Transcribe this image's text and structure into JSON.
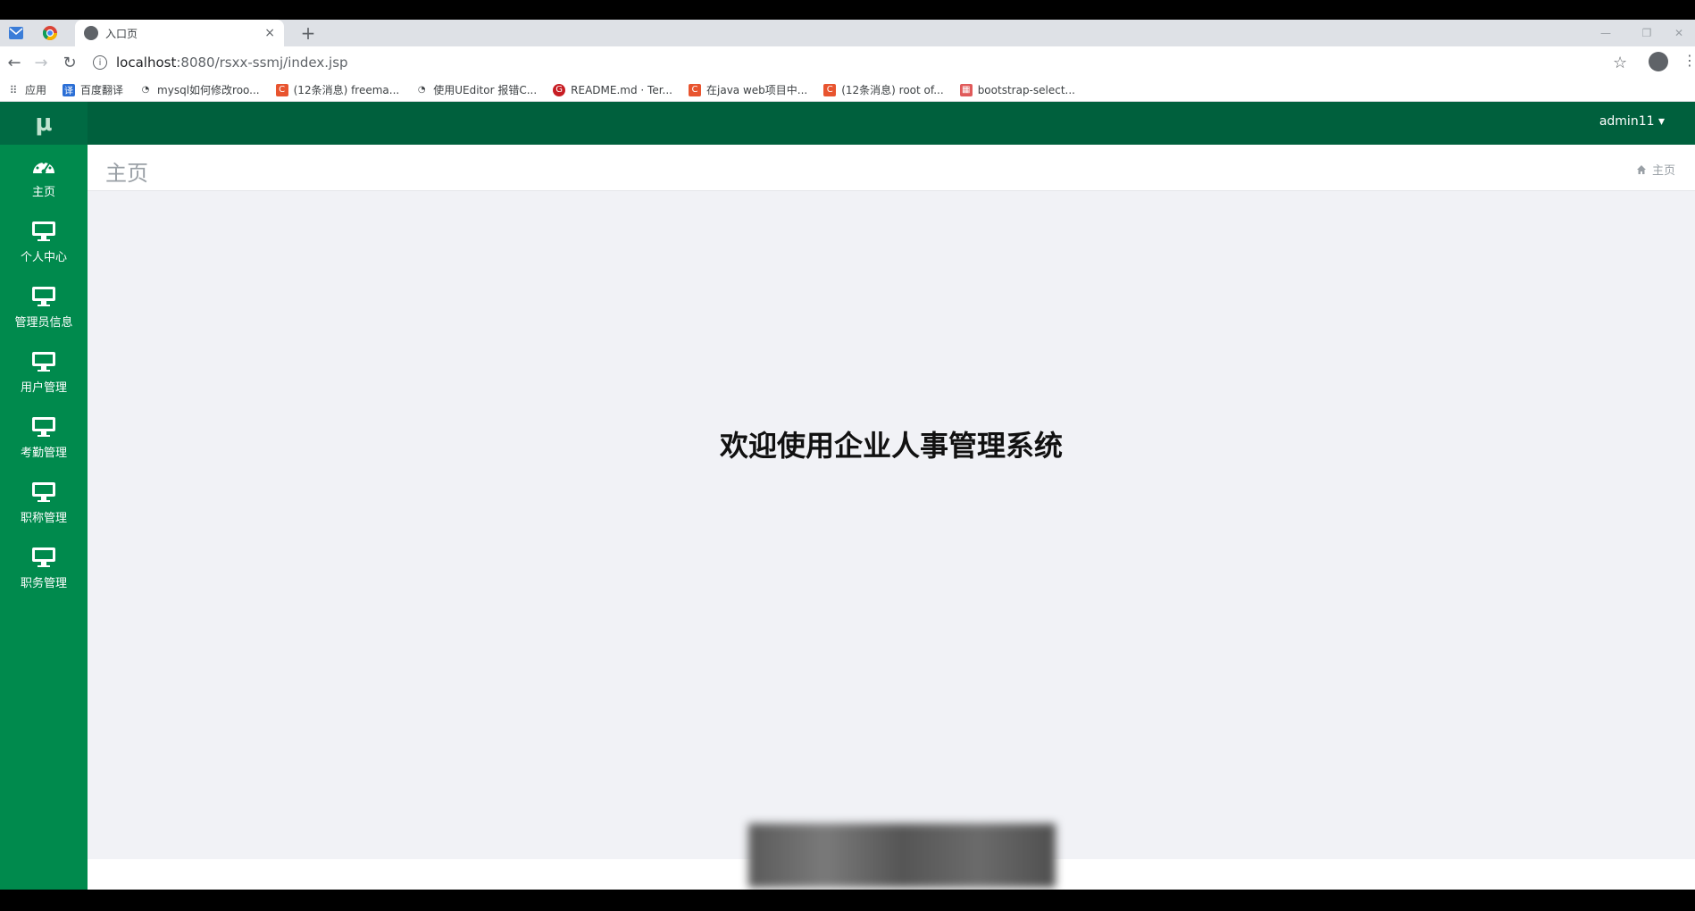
{
  "browser": {
    "tab_title": "入口页",
    "tab_close": "×",
    "new_tab": "+",
    "url_host": "localhost",
    "url_path": ":8080/rsxx-ssmj/index.jsp",
    "bookmarks": [
      "应用",
      "百度翻译",
      "mysql如何修改roo...",
      "(12条消息) freema...",
      "使用UEditor 报错C...",
      "README.md · Ter...",
      "在java web项目中...",
      "(12条消息) root of...",
      "bootstrap-select..."
    ]
  },
  "sidebar": {
    "logo": "μ",
    "items": [
      {
        "label": "主页",
        "icon": "dashboard-icon"
      },
      {
        "label": "个人中心",
        "icon": "monitor-icon"
      },
      {
        "label": "管理员信息",
        "icon": "monitor-icon"
      },
      {
        "label": "用户管理",
        "icon": "monitor-icon"
      },
      {
        "label": "考勤管理",
        "icon": "monitor-icon"
      },
      {
        "label": "职称管理",
        "icon": "monitor-icon"
      },
      {
        "label": "职务管理",
        "icon": "monitor-icon"
      }
    ]
  },
  "header": {
    "user": "admin11 ▾"
  },
  "page": {
    "title": "主页",
    "breadcrumb": "主页",
    "welcome": "欢迎使用企业人事管理系统"
  },
  "colors": {
    "sidebar": "#008a4d",
    "topnav": "#00603d",
    "content_bg": "#f1f2f6"
  }
}
